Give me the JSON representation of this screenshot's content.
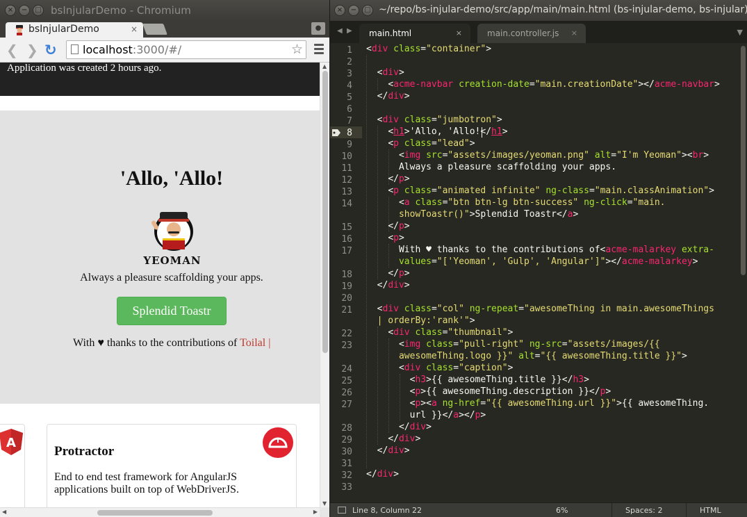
{
  "browser": {
    "window_title": "bsInjularDemo - Chromium",
    "window_controls": [
      "×",
      "−",
      "□"
    ],
    "tab": {
      "label": "bsInjularDemo",
      "close": "×"
    },
    "url_host": "localhost",
    "url_rest": ":3000/#/",
    "navbar_text": "Application was created 2 hours ago.",
    "jumbotron": {
      "title": "'Allo, 'Allo!",
      "logo_caption": "YEOMAN",
      "lead": "Always a pleasure scaffolding your apps.",
      "button_label": "Splendid Toastr",
      "thanks_text": "With ♥ thanks to the contributions of ",
      "malarkey_text": "Toilal |"
    },
    "thumbnail": {
      "title": "Protractor",
      "description": "End to end test framework for AngularJS applications built on top of WebDriverJS."
    }
  },
  "editor": {
    "window_title": "~/repo/bs-injular-demo/src/app/main/main.html (bs-injular-demo, bs-injular)",
    "tabs": [
      {
        "label": "main.html",
        "close": "×",
        "active": true
      },
      {
        "label": "main.controller.js",
        "close": "×",
        "active": false
      }
    ],
    "current_line": 8,
    "lines": [
      "1",
      "2",
      "3",
      "4",
      "5",
      "6",
      "7",
      "8",
      "9",
      "10",
      "11",
      "12",
      "13",
      "14",
      "",
      "15",
      "16",
      "17",
      "",
      "18",
      "19",
      "20",
      "21",
      "",
      "22",
      "23",
      "",
      "24",
      "25",
      "26",
      "27",
      "",
      "28",
      "29",
      "30",
      "31",
      "32",
      "33"
    ],
    "status": {
      "position": "Line 8, Column 22",
      "percent": "6%",
      "spaces": "Spaces: 2",
      "syntax": "HTML"
    }
  }
}
